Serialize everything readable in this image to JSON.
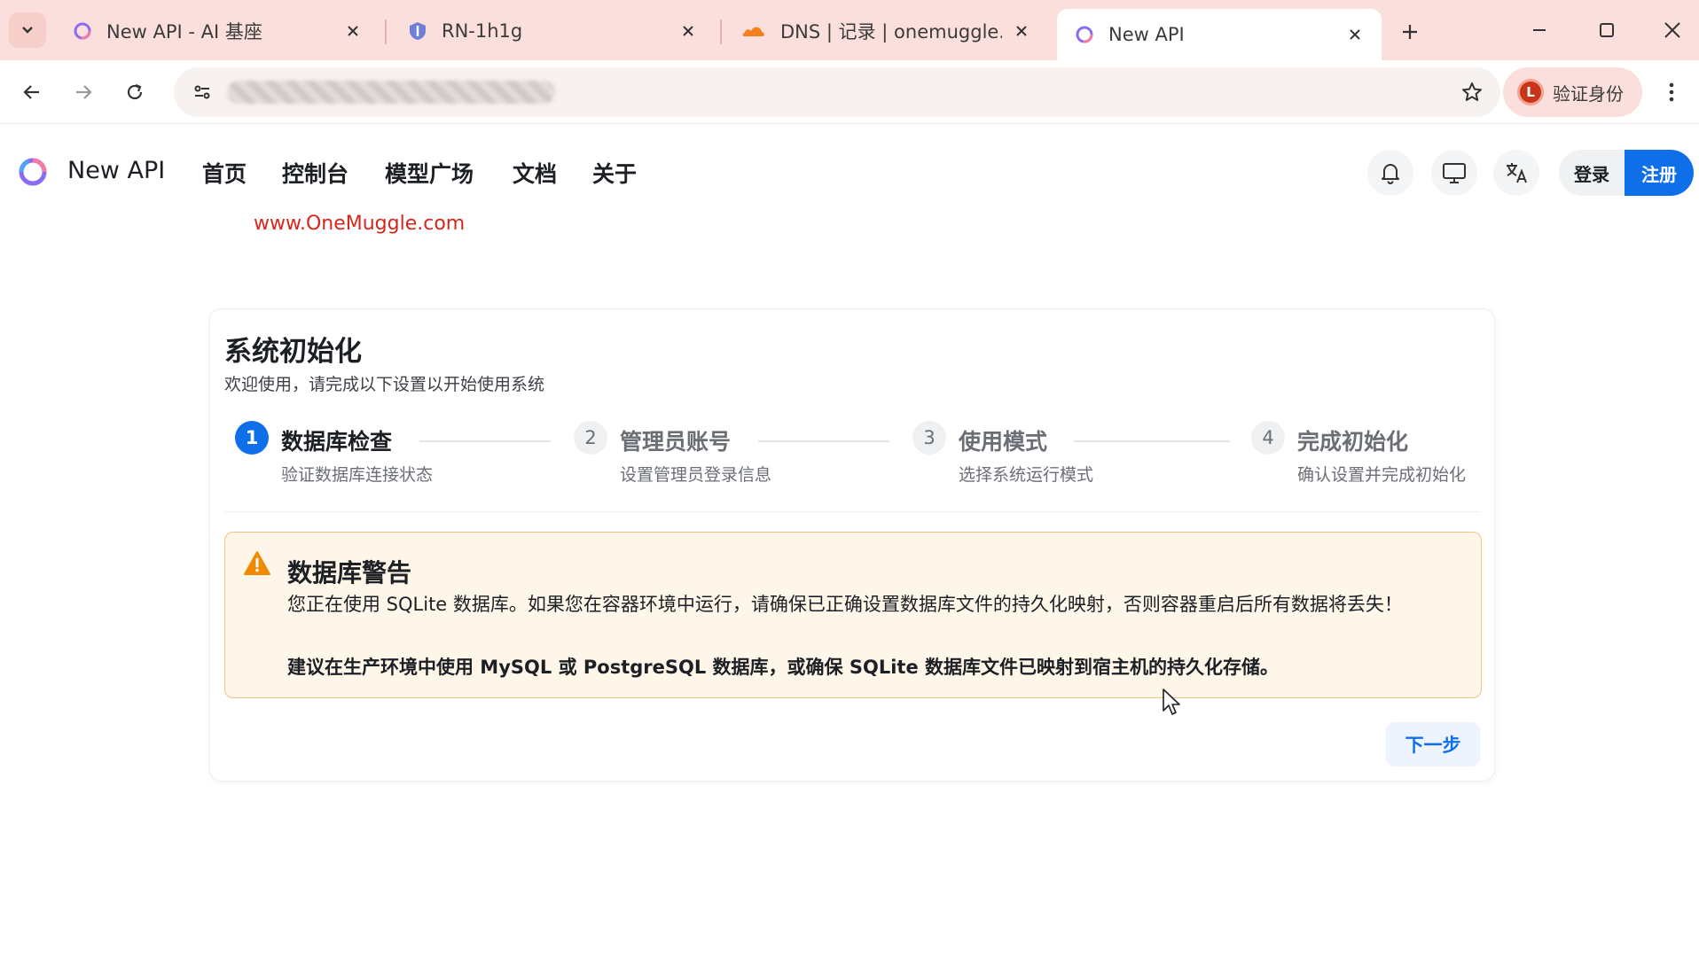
{
  "browser": {
    "tabs": [
      {
        "title": "New API - AI 基座",
        "favicon": "new-api-logo-icon",
        "active": false
      },
      {
        "title": "RN-1h1g",
        "favicon": "shield-icon",
        "active": false
      },
      {
        "title": "DNS | 记录 | onemuggle.com",
        "favicon": "cloudflare-icon",
        "active": false
      },
      {
        "title": "New API",
        "favicon": "new-api-logo-icon",
        "active": true
      }
    ],
    "verify_label": "验证身份",
    "verify_avatar_letter": "L"
  },
  "header": {
    "brand": "New API",
    "nav": [
      "首页",
      "控制台",
      "模型广场",
      "文档",
      "关于"
    ],
    "login": "登录",
    "register": "注册"
  },
  "watermark": "www.OneMuggle.com",
  "setup": {
    "title": "系统初始化",
    "subtitle": "欢迎使用，请完成以下设置以开始使用系统",
    "steps": [
      {
        "num": "1",
        "title": "数据库检查",
        "desc": "验证数据库连接状态",
        "active": true
      },
      {
        "num": "2",
        "title": "管理员账号",
        "desc": "设置管理员登录信息",
        "active": false
      },
      {
        "num": "3",
        "title": "使用模式",
        "desc": "选择系统运行模式",
        "active": false
      },
      {
        "num": "4",
        "title": "完成初始化",
        "desc": "确认设置并完成初始化",
        "active": false
      }
    ],
    "warning": {
      "title": "数据库警告",
      "text": "您正在使用 SQLite 数据库。如果您在容器环境中运行，请确保已正确设置数据库文件的持久化映射，否则容器重启后所有数据将丢失！",
      "strong": "建议在生产环境中使用 MySQL 或 PostgreSQL 数据库，或确保 SQLite 数据库文件已映射到宿主机的持久化存储。"
    },
    "next": "下一步"
  },
  "colors": {
    "primary": "#0f6fe8",
    "warning_bg": "#fff6ea",
    "warning_border": "#f3c089",
    "warning_icon": "#f08a00",
    "watermark": "#d8261c",
    "tabstrip": "#fbdfdc"
  }
}
